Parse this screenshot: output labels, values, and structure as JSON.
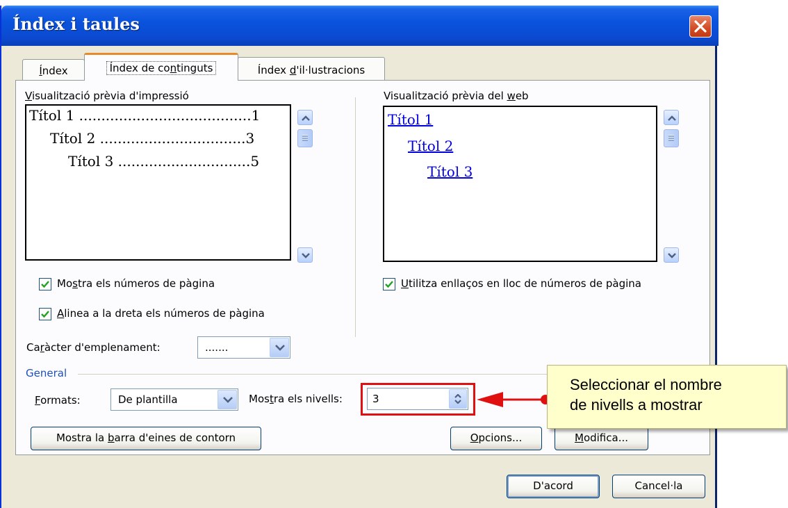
{
  "dialog": {
    "title": "Índex i taules",
    "tabs": [
      {
        "pre": "",
        "u": "Í",
        "post": "ndex"
      },
      {
        "pre": "Índex de co",
        "u": "n",
        "post": "tinguts"
      },
      {
        "pre": "Índex ",
        "u": "d",
        "post": "'il·lustracions"
      }
    ],
    "active_tab": 1
  },
  "print_preview": {
    "label_pre": "",
    "label_u": "V",
    "label_post": "isualització prèvia d'impressió",
    "entries": [
      {
        "text": "Títol 1 .......................................1"
      },
      {
        "text": "Títol 2 .................................3"
      },
      {
        "text": "Títol 3 ..............................5"
      }
    ]
  },
  "web_preview": {
    "label_pre": "Visualització prèvia del ",
    "label_u": "w",
    "label_post": "eb",
    "links": [
      "Títol 1",
      "Títol 2",
      "Títol 3"
    ]
  },
  "options": {
    "show_page_numbers": {
      "pre": "Mo",
      "u": "s",
      "post": "tra els números de pàgina",
      "checked": true
    },
    "right_align": {
      "pre": "",
      "u": "A",
      "post": "linea a la dreta els números de pàgina",
      "checked": true
    },
    "use_hyperlinks": {
      "pre": "",
      "u": "U",
      "post": "tilitza enllaços en lloc de números de pàgina",
      "checked": true
    },
    "tab_leader": {
      "pre": "Ca",
      "u": "r",
      "post": "àcter d'emplenament:",
      "value": "......."
    }
  },
  "general": {
    "group_label": "General",
    "formats": {
      "pre": "",
      "u": "F",
      "post": "ormats:",
      "value": "De plantilla"
    },
    "levels": {
      "pre": "Mos",
      "u": "t",
      "post": "ra els nivells:",
      "value": "3"
    }
  },
  "buttons": {
    "outline": {
      "pre": "Mostra la ",
      "u": "b",
      "post": "arra d'eines de contorn"
    },
    "options": {
      "pre": "",
      "u": "O",
      "post": "pcions..."
    },
    "modify": {
      "pre": "",
      "u": "M",
      "post": "odifica..."
    },
    "ok": "D'acord",
    "cancel": "Cancel·la"
  },
  "annotation": {
    "lines": [
      "Seleccionar el nombre",
      "de nivells a mostrar"
    ],
    "color": "#e01010"
  }
}
